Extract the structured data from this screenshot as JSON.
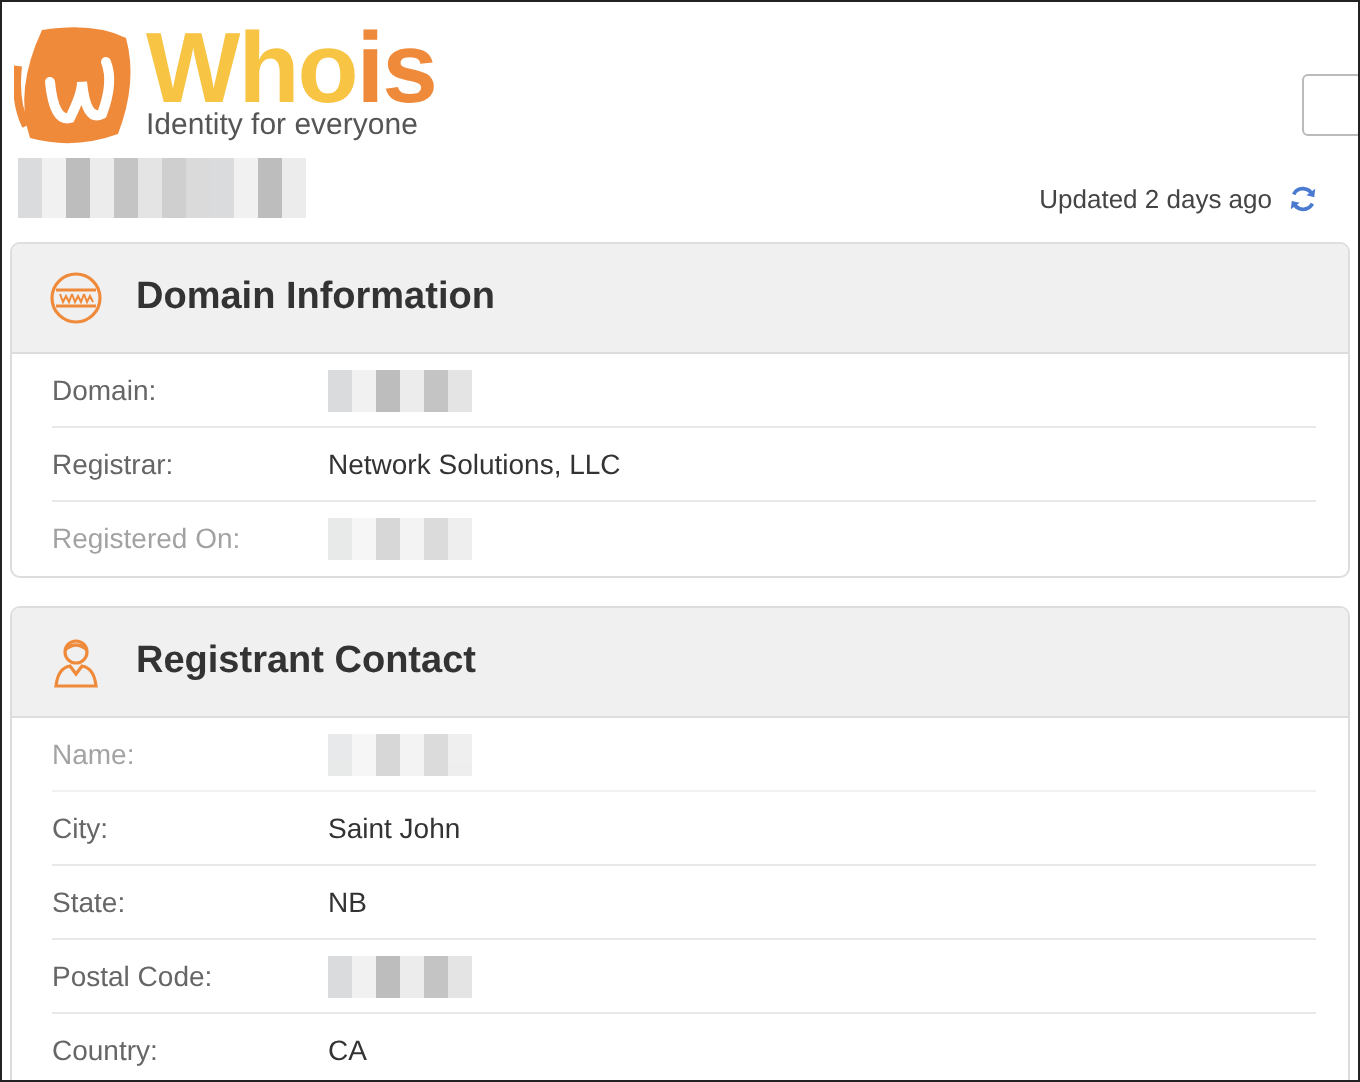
{
  "logo": {
    "brand_parts": [
      {
        "text": "Who",
        "color": "#f7c443"
      },
      {
        "text": "is",
        "color": "#ef8a3b"
      }
    ],
    "tagline": "Identity for everyone"
  },
  "header": {
    "title_redacted": true,
    "updated": "Updated 2 days ago"
  },
  "sections": [
    {
      "title": "Domain Information",
      "kind": "www",
      "rows": [
        {
          "label": "Domain:",
          "value": "",
          "redacted": true,
          "faded": false
        },
        {
          "label": "Registrar:",
          "value": "Network Solutions, LLC",
          "redacted": false,
          "faded": false
        },
        {
          "label": "Registered On:",
          "value": "",
          "redacted": true,
          "faded": true
        }
      ]
    },
    {
      "title": "Registrant Contact",
      "kind": "person",
      "rows": [
        {
          "label": "Name:",
          "value": "",
          "redacted": true,
          "faded": true
        },
        {
          "label": "City:",
          "value": "Saint John",
          "redacted": false,
          "faded": false
        },
        {
          "label": "State:",
          "value": "NB",
          "redacted": false,
          "faded": false
        },
        {
          "label": "Postal Code:",
          "value": "",
          "redacted": true,
          "faded": false
        },
        {
          "label": "Country:",
          "value": "CA",
          "redacted": false,
          "faded": false
        }
      ]
    }
  ]
}
